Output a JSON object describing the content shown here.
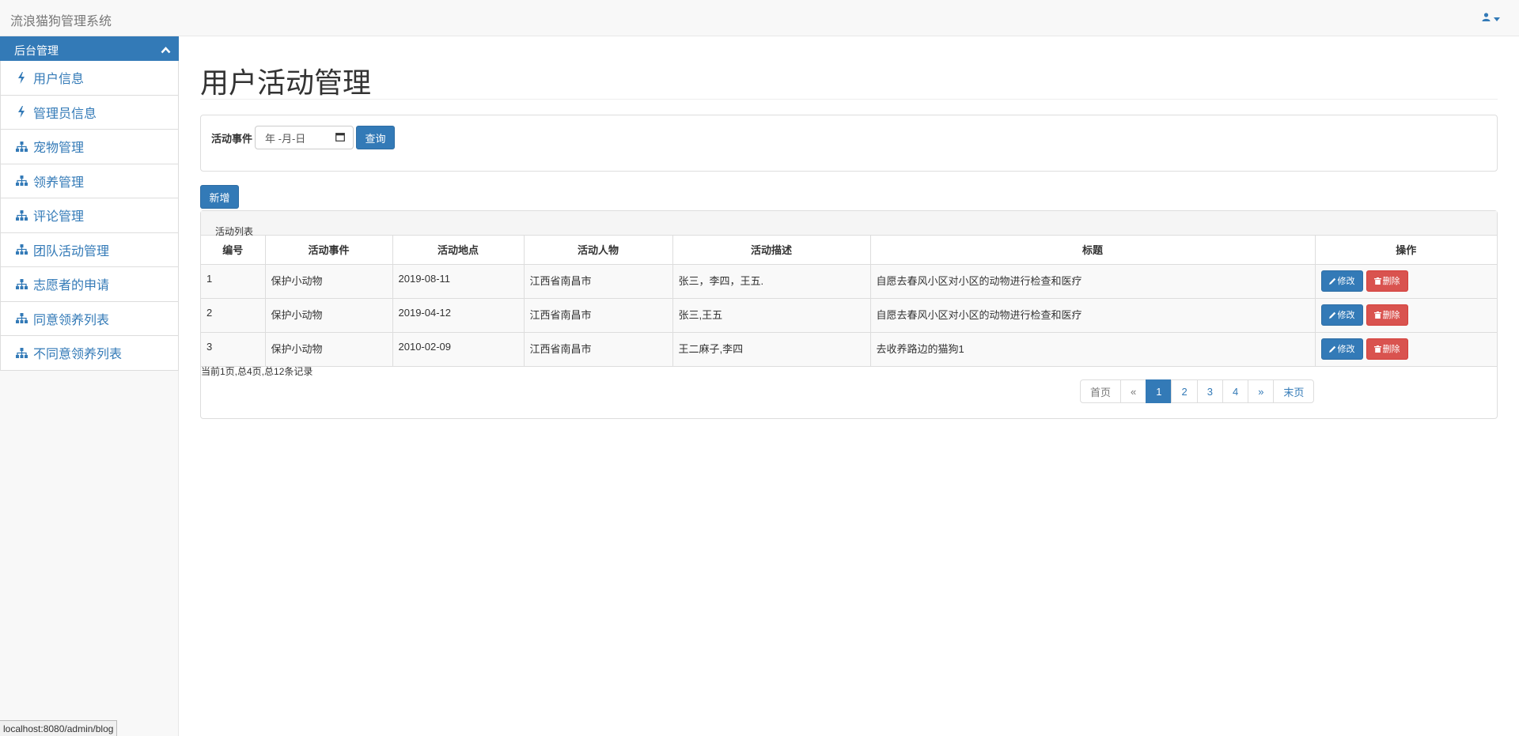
{
  "app": {
    "title": "流浪猫狗管理系统"
  },
  "sidebar": {
    "header": "后台管理",
    "items": [
      {
        "label": "用户信息",
        "icon": "bolt-icon"
      },
      {
        "label": "管理员信息",
        "icon": "bolt-icon"
      },
      {
        "label": "宠物管理",
        "icon": "sitemap-icon"
      },
      {
        "label": "领养管理",
        "icon": "sitemap-icon"
      },
      {
        "label": "评论管理",
        "icon": "sitemap-icon"
      },
      {
        "label": "团队活动管理",
        "icon": "sitemap-icon"
      },
      {
        "label": "志愿者的申请",
        "icon": "sitemap-icon"
      },
      {
        "label": "同意领养列表",
        "icon": "sitemap-icon"
      },
      {
        "label": "不同意领养列表",
        "icon": "sitemap-icon"
      }
    ]
  },
  "main": {
    "page_title": "用户活动管理",
    "search": {
      "label": "活动事件",
      "date_placeholder": "年 -月-日",
      "button": "查询"
    },
    "add_button": "新增",
    "list": {
      "title": "活动列表",
      "columns": [
        "编号",
        "活动事件",
        "活动地点",
        "活动人物",
        "活动描述",
        "标题",
        "操作"
      ],
      "rows": [
        {
          "id": "1",
          "event": "保护小动物",
          "date": "2019-08-11",
          "place": "江西省南昌市",
          "people": "张三，李四，王五.",
          "title": "自愿去春风小区对小区的动物进行检查和医疗"
        },
        {
          "id": "2",
          "event": "保护小动物",
          "date": "2019-04-12",
          "place": "江西省南昌市",
          "people": "张三,王五",
          "title": "自愿去春风小区对小区的动物进行检查和医疗"
        },
        {
          "id": "3",
          "event": "保护小动物",
          "date": "2010-02-09",
          "place": "江西省南昌市",
          "people": "王二麻子,李四",
          "title": "去收养路边的猫狗1"
        }
      ],
      "edit_label": "修改",
      "delete_label": "删除",
      "record_info": "当前1页,总4页,总12条记录"
    },
    "pager": {
      "first": "首页",
      "prev": "«",
      "pages": [
        "1",
        "2",
        "3",
        "4"
      ],
      "next": "»",
      "last": "末页"
    }
  },
  "status_url": "localhost:8080/admin/blog"
}
